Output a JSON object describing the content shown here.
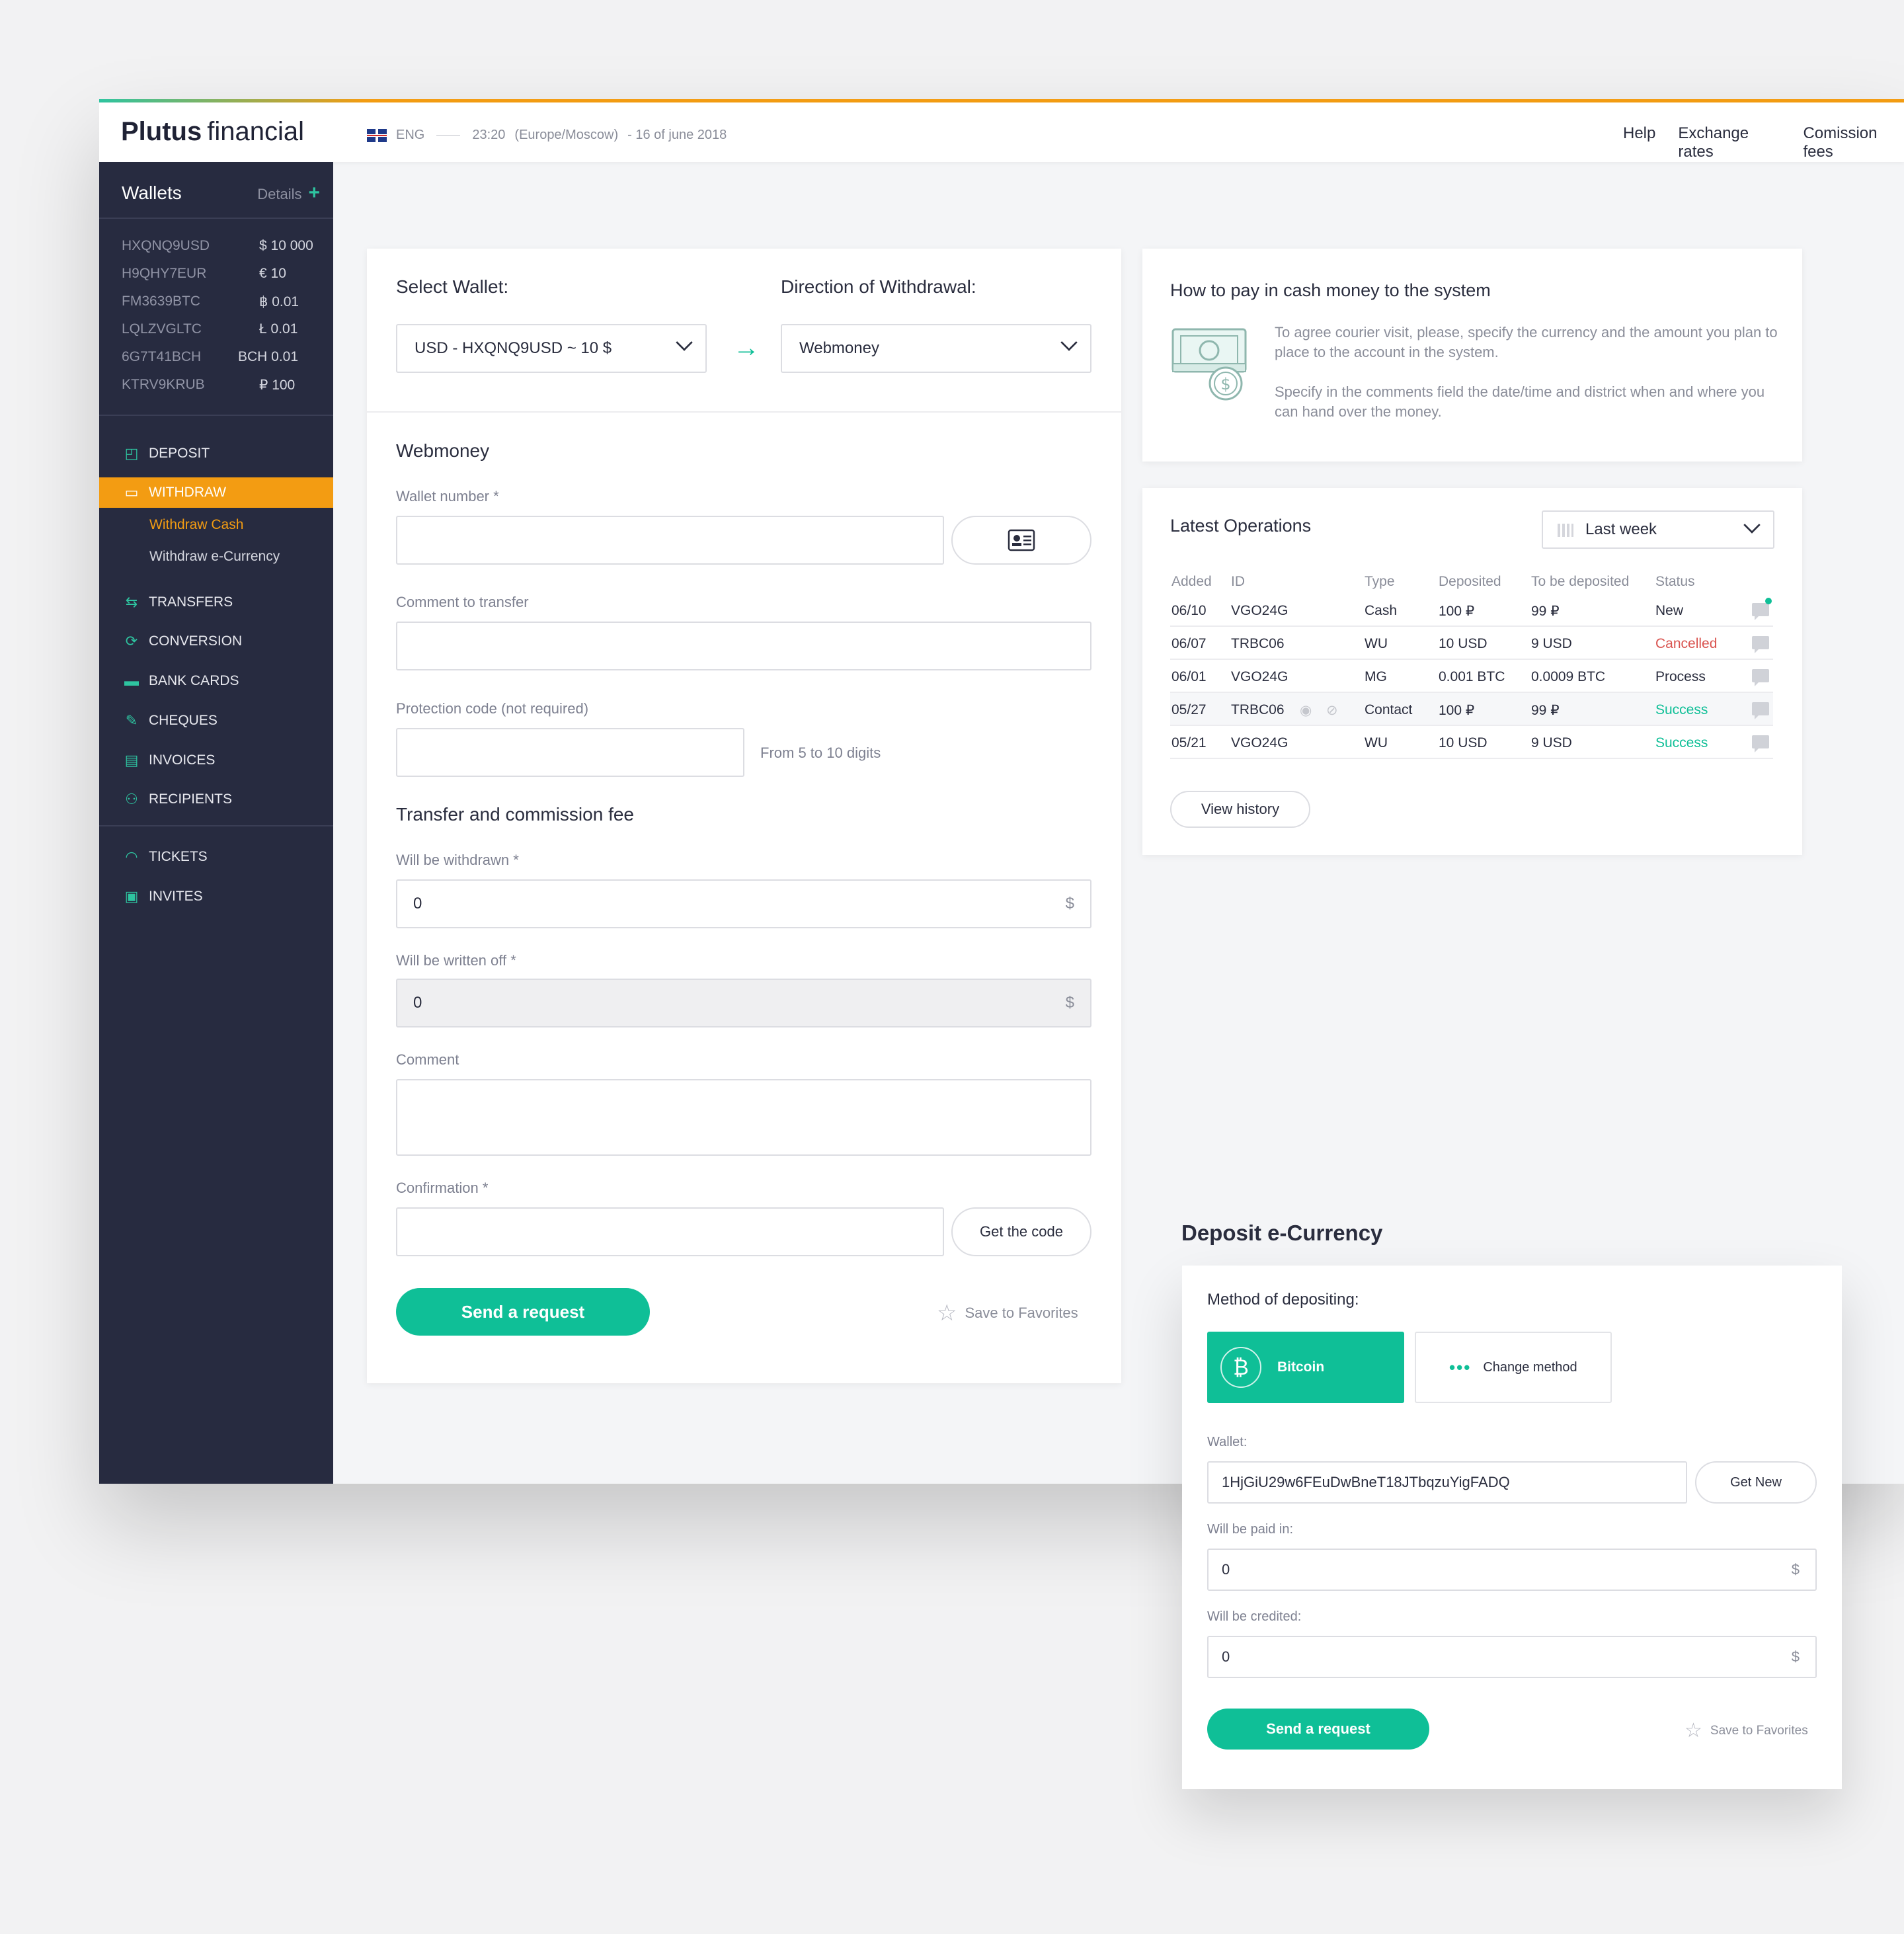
{
  "header": {
    "brand_bold": "Plutus",
    "brand_light": "financial",
    "lang": "ENG",
    "time": "23:20",
    "timezone": "(Europe/Moscow)",
    "date": "- 16 of june 2018",
    "nav": [
      "Help",
      "Exchange rates",
      "Comission fees"
    ]
  },
  "sidebar": {
    "wallets_title": "Wallets",
    "details_label": "Details",
    "wallets": [
      {
        "id": "HXQNQ9USD",
        "amount": "$ 10 000"
      },
      {
        "id": "H9QHY7EUR",
        "amount": "€ 10"
      },
      {
        "id": "FM3639BTC",
        "amount": "฿ 0.01"
      },
      {
        "id": "LQLZVGLTC",
        "amount": "Ł 0.01"
      },
      {
        "id": "6G7T41BCH",
        "amount": "BCH 0.01"
      },
      {
        "id": "KTRV9KRUB",
        "amount": "₽ 100"
      }
    ],
    "nav": [
      {
        "label": "DEPOSIT",
        "icon": "wallet-icon"
      },
      {
        "label": "WITHDRAW",
        "icon": "withdraw-icon"
      },
      {
        "label": "TRANSFERS",
        "icon": "transfer-icon"
      },
      {
        "label": "CONVERSION",
        "icon": "conversion-icon"
      },
      {
        "label": "BANK CARDS",
        "icon": "card-icon"
      },
      {
        "label": "CHEQUES",
        "icon": "cheque-icon"
      },
      {
        "label": "INVOICES",
        "icon": "invoice-icon"
      },
      {
        "label": "RECIPIENTS",
        "icon": "recipients-icon"
      },
      {
        "label": "TICKETS",
        "icon": "headset-icon"
      },
      {
        "label": "INVITES",
        "icon": "invite-icon"
      }
    ],
    "withdraw_sub": [
      "Withdraw Cash",
      "Withdraw e-Currency"
    ]
  },
  "withdraw_form": {
    "select_wallet_label": "Select Wallet:",
    "select_wallet_value": "USD - HXQNQ9USD ~ 10 $",
    "direction_label": "Direction of Withdrawal:",
    "direction_value": "Webmoney",
    "section_title": "Webmoney",
    "wallet_number_label": "Wallet number *",
    "wallet_number_value": "",
    "comment_transfer_label": "Comment to transfer",
    "comment_transfer_value": "",
    "protection_label": "Protection code (not required)",
    "protection_value": "",
    "protection_hint": "From 5 to 10 digits",
    "fee_title": "Transfer and commission fee",
    "withdrawn_label": "Will be withdrawn *",
    "withdrawn_value": "0",
    "written_off_label": "Will be written off *",
    "written_off_value": "0",
    "currency_symbol": "$",
    "comment_label": "Comment",
    "comment_value": "",
    "confirmation_label": "Confirmation *",
    "confirmation_value": "",
    "get_code_label": "Get the code",
    "send_label": "Send a request",
    "favorites_label": "Save to Favorites"
  },
  "howto": {
    "title": "How to pay in cash money to the system",
    "p1": "To agree courier visit, please, specify the currency and the amount you plan to place to the account in the system.",
    "p2": "Specify in the comments field the date/time and district when and where you can hand over the money."
  },
  "operations": {
    "title": "Latest Operations",
    "period": "Last week",
    "columns": [
      "Added",
      "ID",
      "Type",
      "Deposited",
      "To be deposited",
      "Status"
    ],
    "rows": [
      {
        "added": "06/10",
        "id": "VGO24G",
        "type": "Cash",
        "deposited": "100 ₽",
        "to_be": "99 ₽",
        "status": "New",
        "status_color": "#2a2d3e"
      },
      {
        "added": "06/07",
        "id": "TRBC06",
        "type": "WU",
        "deposited": "10 USD",
        "to_be": "9 USD",
        "status": "Cancelled",
        "status_color": "#d9534f"
      },
      {
        "added": "06/01",
        "id": "VGO24G",
        "type": "MG",
        "deposited": "0.001 BTC",
        "to_be": "0.0009 BTC",
        "status": "Process",
        "status_color": "#2a2d3e"
      },
      {
        "added": "05/27",
        "id": "TRBC06",
        "type": "Contact",
        "deposited": "100 ₽",
        "to_be": "99 ₽",
        "status": "Success",
        "status_color": "#0fbf97"
      },
      {
        "added": "05/21",
        "id": "VGO24G",
        "type": "WU",
        "deposited": "10 USD",
        "to_be": "9 USD",
        "status": "Success",
        "status_color": "#0fbf97"
      }
    ],
    "view_history": "View history"
  },
  "deposit": {
    "title": "Deposit e-Currency",
    "method_label": "Method of depositing:",
    "method_selected": "Bitcoin",
    "change_method": "Change method",
    "wallet_label": "Wallet:",
    "wallet_value": "1HjGiU29w6FEuDwBneT18JTbqzuYigFADQ",
    "get_new": "Get New",
    "paid_in_label": "Will be paid in:",
    "paid_in_value": "0",
    "credited_label": "Will be credited:",
    "credited_value": "0",
    "currency_symbol": "$",
    "send_label": "Send a request",
    "favorites_label": "Save to Favorites"
  },
  "colors": {
    "accent": "#0fbf97",
    "orange": "#f39c12",
    "sidebar": "#272b40"
  }
}
